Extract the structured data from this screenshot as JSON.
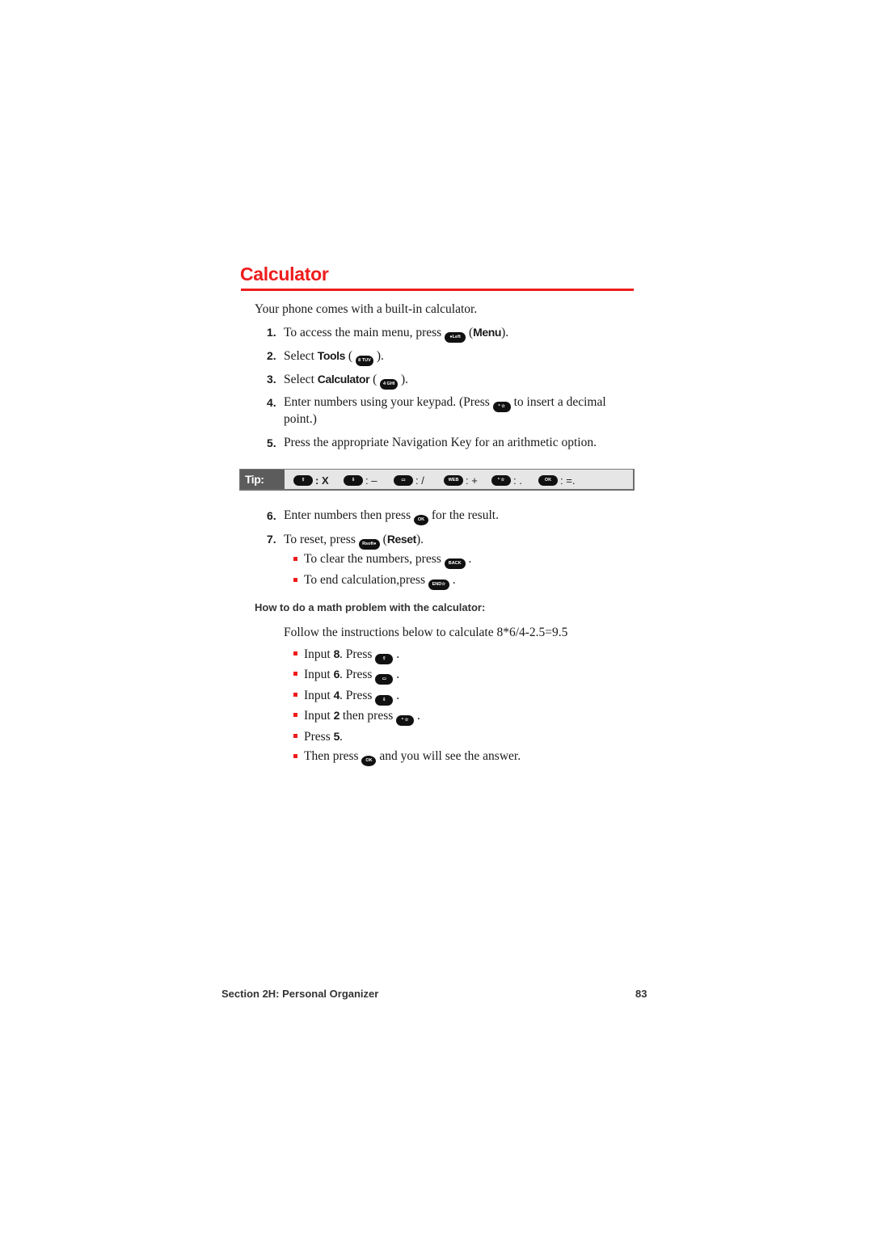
{
  "page": {
    "title": "Calculator",
    "intro": "Your phone comes with a built-in calculator.",
    "steps": [
      {
        "num": "1.",
        "before": "To access the main menu, press ",
        "key": "●Left",
        "after_open": " (",
        "bold": "Menu",
        "after": ")."
      },
      {
        "num": "2.",
        "before": "Select ",
        "bold": "Tools",
        "paren_open": " ( ",
        "key": "8 TUV",
        "after": " )."
      },
      {
        "num": "3.",
        "before": "Select ",
        "bold": "Calculator",
        "paren_open": " ( ",
        "key": "4 GHI",
        "after": " )."
      },
      {
        "num": "4.",
        "before": "Enter numbers using your keypad. (Press ",
        "key": "* ☆",
        "after": " to insert a decimal",
        "line2": "point.)"
      },
      {
        "num": "5.",
        "text": "Press the appropriate Navigation Key for an arithmetic option."
      }
    ],
    "tip": {
      "label": "Tip:",
      "items": [
        {
          "key": "⇧",
          "key_name": "nav-up",
          "op": ": X"
        },
        {
          "key": "⇩",
          "key_name": "nav-down",
          "op": ": –"
        },
        {
          "key": "▭",
          "key_name": "nav-left",
          "op": ": /"
        },
        {
          "key": "WEB",
          "key_name": "nav-right-web",
          "op": ": +"
        },
        {
          "key": "* ☆",
          "key_name": "star-key",
          "op": ": ."
        },
        {
          "key": "OK",
          "key_name": "ok-key",
          "op": ": =."
        }
      ]
    },
    "steps2": [
      {
        "num": "6.",
        "before": "Enter numbers then press ",
        "key": "OK",
        "after": " for the result."
      },
      {
        "num": "7.",
        "before": "To reset, press ",
        "key": "Rsoft●",
        "after_open": " (",
        "bold": "Reset",
        "after": ")."
      }
    ],
    "sub_bullets": [
      {
        "before": "To clear the numbers, press ",
        "key": "BACK",
        "after": " ."
      },
      {
        "before": "To end calculation,press ",
        "key": "END☆",
        "after": " ."
      }
    ],
    "howto": {
      "heading": "How to do a math problem with the calculator:",
      "intro": "Follow the instructions below to calculate 8*6/4-2.5=9.5",
      "items": [
        {
          "before": "Input ",
          "bold": "8",
          "mid": ". Press ",
          "key": "⇧",
          "after": " ."
        },
        {
          "before": "Input ",
          "bold": "6",
          "mid": ". Press ",
          "key": "▭",
          "after": " ."
        },
        {
          "before": "Input ",
          "bold": "4",
          "mid": ". Press ",
          "key": "⇩",
          "after": " ."
        },
        {
          "before": "Input ",
          "bold": "2",
          "mid": " then press ",
          "key": "* ☆",
          "after": " ."
        },
        {
          "before": "Press ",
          "bold": "5",
          "mid": ".",
          "key": "",
          "after": ""
        },
        {
          "before": "Then press ",
          "bold": "",
          "mid": "",
          "key": "OK",
          "after": " and you will see the answer."
        }
      ]
    },
    "footer": {
      "section": "Section 2H: Personal Organizer",
      "page_number": "83"
    }
  },
  "colors": {
    "accent": "#ee1c1c",
    "tip_label_bg": "#5c5c5c",
    "tip_bg": "#e6e6e6",
    "key_bg": "#111111"
  }
}
